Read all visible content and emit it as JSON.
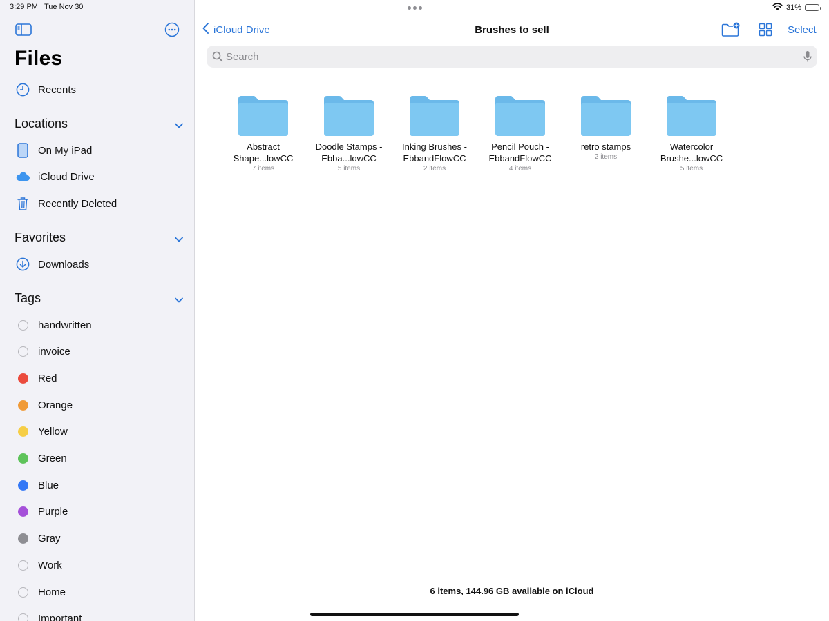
{
  "status": {
    "time": "3:29 PM",
    "date": "Tue Nov 30",
    "battery": "31%",
    "battery_level": 0.31
  },
  "sidebar": {
    "title": "Files",
    "recents": {
      "label": "Recents",
      "icon": "clock-icon"
    },
    "locations": {
      "header": "Locations",
      "items": [
        {
          "label": "On My iPad",
          "icon": "ipad-icon"
        },
        {
          "label": "iCloud Drive",
          "icon": "icloud-icon"
        },
        {
          "label": "Recently Deleted",
          "icon": "trash-icon"
        }
      ]
    },
    "favorites": {
      "header": "Favorites",
      "items": [
        {
          "label": "Downloads",
          "icon": "download-icon"
        }
      ]
    },
    "tags": {
      "header": "Tags",
      "items": [
        {
          "label": "handwritten",
          "color": ""
        },
        {
          "label": "invoice",
          "color": ""
        },
        {
          "label": "Red",
          "color": "#eb4b3d"
        },
        {
          "label": "Orange",
          "color": "#f09a37"
        },
        {
          "label": "Yellow",
          "color": "#f6ce46"
        },
        {
          "label": "Green",
          "color": "#5ec35a"
        },
        {
          "label": "Blue",
          "color": "#3478f6"
        },
        {
          "label": "Purple",
          "color": "#a550d9"
        },
        {
          "label": "Gray",
          "color": "#8e8e93"
        },
        {
          "label": "Work",
          "color": ""
        },
        {
          "label": "Home",
          "color": ""
        },
        {
          "label": "Important",
          "color": ""
        }
      ]
    }
  },
  "nav": {
    "back_label": "iCloud Drive",
    "title": "Brushes to sell",
    "select_label": "Select"
  },
  "search": {
    "placeholder": "Search"
  },
  "folders": [
    {
      "name": "Abstract Shape...lowCC",
      "count": "7 items"
    },
    {
      "name": "Doodle Stamps - Ebba...lowCC",
      "count": "5 items"
    },
    {
      "name": "Inking Brushes - EbbandFlowCC",
      "count": "2 items"
    },
    {
      "name": "Pencil Pouch - EbbandFlowCC",
      "count": "4 items"
    },
    {
      "name": "retro stamps",
      "count": "2 items"
    },
    {
      "name": "Watercolor Brushe...lowCC",
      "count": "5 items"
    }
  ],
  "footer": {
    "summary": "6 items, 144.96 GB available on iCloud"
  },
  "colors": {
    "accent": "#2a75d8",
    "folder": "#7ec8f2",
    "sidebar_bg": "#f2f2f7"
  }
}
